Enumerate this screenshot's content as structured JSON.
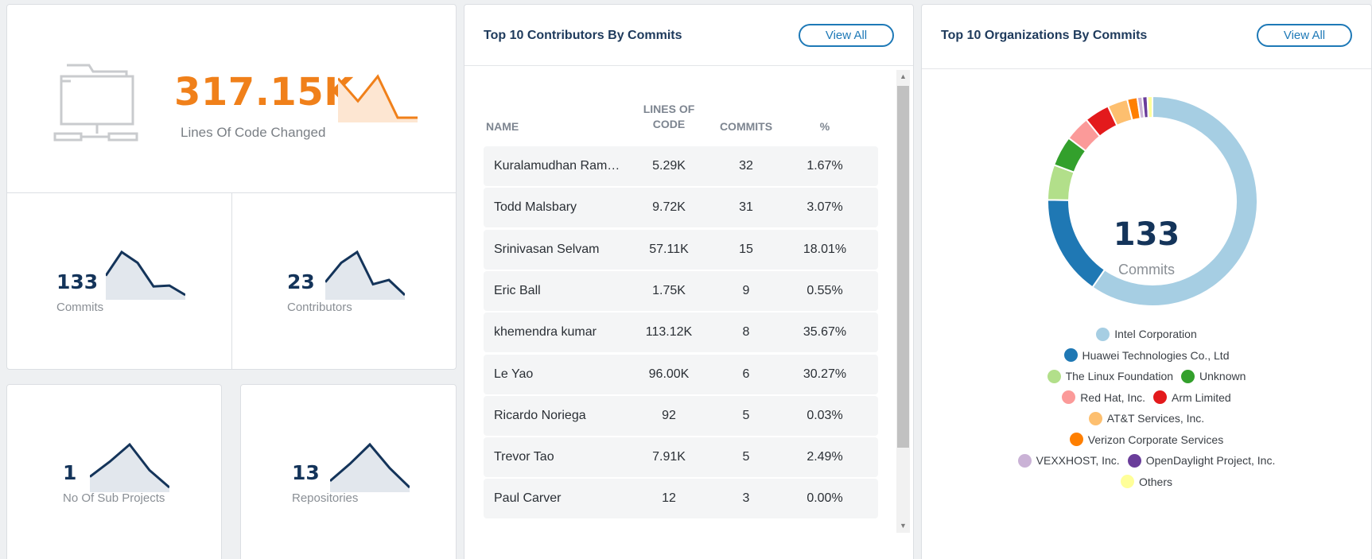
{
  "summary": {
    "lines_of_code": {
      "value": "317.15K",
      "label": "Lines Of Code Changed",
      "trend": [
        0.95,
        0.4,
        1.0,
        0.0,
        0.0
      ]
    },
    "commits": {
      "value": "133",
      "label": "Commits",
      "trend": [
        0.45,
        1.0,
        0.75,
        0.2,
        0.22,
        0.0
      ]
    },
    "contributors": {
      "value": "23",
      "label": "Contributors",
      "trend": [
        0.3,
        0.75,
        1.0,
        0.25,
        0.35,
        0.0
      ]
    },
    "sub_projects": {
      "value": "1",
      "label": "No Of Sub Projects",
      "trend": [
        0.25,
        0.6,
        1.0,
        0.4,
        0.0
      ]
    },
    "repositories": {
      "value": "13",
      "label": "Repositories",
      "trend": [
        0.15,
        0.55,
        1.0,
        0.45,
        0.0
      ]
    }
  },
  "contributors_card": {
    "title": "Top 10 Contributors By Commits",
    "view_all": "View All",
    "columns": {
      "name": "NAME",
      "loc": "LINES OF CODE",
      "commits": "COMMITS",
      "pct": "%"
    },
    "rows": [
      {
        "name": "Kuralamudhan Ramakrishnan",
        "loc": "5.29K",
        "commits": "32",
        "pct": "1.67%"
      },
      {
        "name": "Todd Malsbary",
        "loc": "9.72K",
        "commits": "31",
        "pct": "3.07%"
      },
      {
        "name": "Srinivasan Selvam",
        "loc": "57.11K",
        "commits": "15",
        "pct": "18.01%"
      },
      {
        "name": "Eric Ball",
        "loc": "1.75K",
        "commits": "9",
        "pct": "0.55%"
      },
      {
        "name": "khemendra kumar",
        "loc": "113.12K",
        "commits": "8",
        "pct": "35.67%"
      },
      {
        "name": "Le Yao",
        "loc": "96.00K",
        "commits": "6",
        "pct": "30.27%"
      },
      {
        "name": "Ricardo Noriega",
        "loc": "92",
        "commits": "5",
        "pct": "0.03%"
      },
      {
        "name": "Trevor Tao",
        "loc": "7.91K",
        "commits": "5",
        "pct": "2.49%"
      },
      {
        "name": "Paul Carver",
        "loc": "12",
        "commits": "3",
        "pct": "0.00%"
      }
    ]
  },
  "organizations_card": {
    "title": "Top 10 Organizations By Commits",
    "view_all": "View All",
    "center_value": "133",
    "center_label": "Commits",
    "legend_rows": [
      [
        0
      ],
      [
        1
      ],
      [
        2,
        3
      ],
      [
        4,
        5
      ],
      [
        6
      ],
      [
        7
      ],
      [
        8,
        9
      ],
      [
        10
      ]
    ]
  },
  "chart_data": {
    "type": "pie",
    "donut": true,
    "categories": [
      "Intel Corporation",
      "Huawei Technologies Co., Ltd",
      "The Linux Foundation",
      "Unknown",
      "Red Hat, Inc.",
      "Arm Limited",
      "AT&T Services, Inc.",
      "Verizon Corporate Services",
      "VEXXHOST, Inc.",
      "OpenDaylight Project, Inc.",
      "Others"
    ],
    "values": [
      77,
      20,
      7,
      6,
      5,
      5,
      4,
      2,
      1,
      1,
      1
    ],
    "colors": [
      "#a6cee3",
      "#1f78b4",
      "#b2df8a",
      "#33a02c",
      "#fb9a99",
      "#e31a1c",
      "#fdbf6f",
      "#ff7f00",
      "#cab2d6",
      "#6a3d9a",
      "#ffff99"
    ],
    "legend": "bottom"
  },
  "icons": {
    "folder": "network-folder-icon",
    "scroll_up": "caret-up-icon",
    "scroll_down": "caret-down-icon"
  }
}
